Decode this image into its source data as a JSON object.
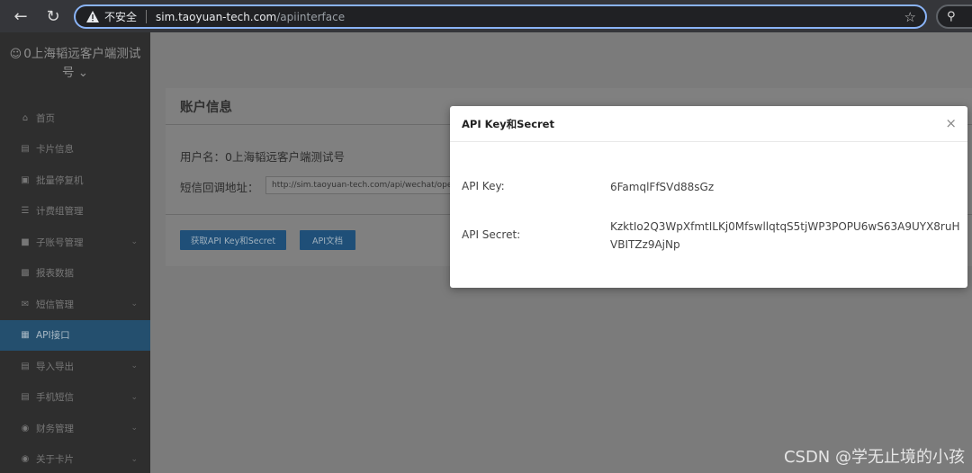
{
  "browser": {
    "insecure_label": "不安全",
    "url_host": "sim.taoyuan-tech.com",
    "url_path": "/apiinterface",
    "search_icon": "search-icon"
  },
  "sidebar": {
    "user_line1": "0上海韬远客户端测试",
    "user_line2": "号",
    "items": [
      {
        "label": "首页",
        "icon": "home-icon"
      },
      {
        "label": "卡片信息",
        "icon": "card-icon"
      },
      {
        "label": "批量停复机",
        "icon": "batch-icon"
      },
      {
        "label": "计费组管理",
        "icon": "list-icon"
      },
      {
        "label": "子账号管理",
        "icon": "account-icon"
      },
      {
        "label": "报表数据",
        "icon": "chart-icon"
      },
      {
        "label": "短信管理",
        "icon": "sms-icon"
      },
      {
        "label": "API接口",
        "icon": "api-icon"
      },
      {
        "label": "导入导出",
        "icon": "import-export-icon"
      },
      {
        "label": "手机短信",
        "icon": "phone-icon"
      },
      {
        "label": "财务管理",
        "icon": "finance-icon"
      },
      {
        "label": "关于卡片",
        "icon": "info-icon"
      }
    ]
  },
  "account": {
    "title": "账户信息",
    "username_label": "用户名：",
    "username_value": "0上海韬远客户端测试号",
    "callback_label": "短信回调地址：",
    "callback_value": "http://sim.taoyuan-tech.com/api/wechat/oper",
    "btn_get": "获取API Key和Secret",
    "btn_doc": "API文档"
  },
  "modal": {
    "title": "API Key和Secret",
    "close": "×",
    "key_label": "API Key:",
    "key_value": "6FamqlFfSVd88sGz",
    "secret_label": "API Secret:",
    "secret_value": "KzktIo2Q3WpXfmtILKj0MfswllqtqS5tjWP3POPU6wS63A9UYX8ruHVBITZz9AjNp"
  },
  "watermark": "CSDN @学无止境的小孩"
}
